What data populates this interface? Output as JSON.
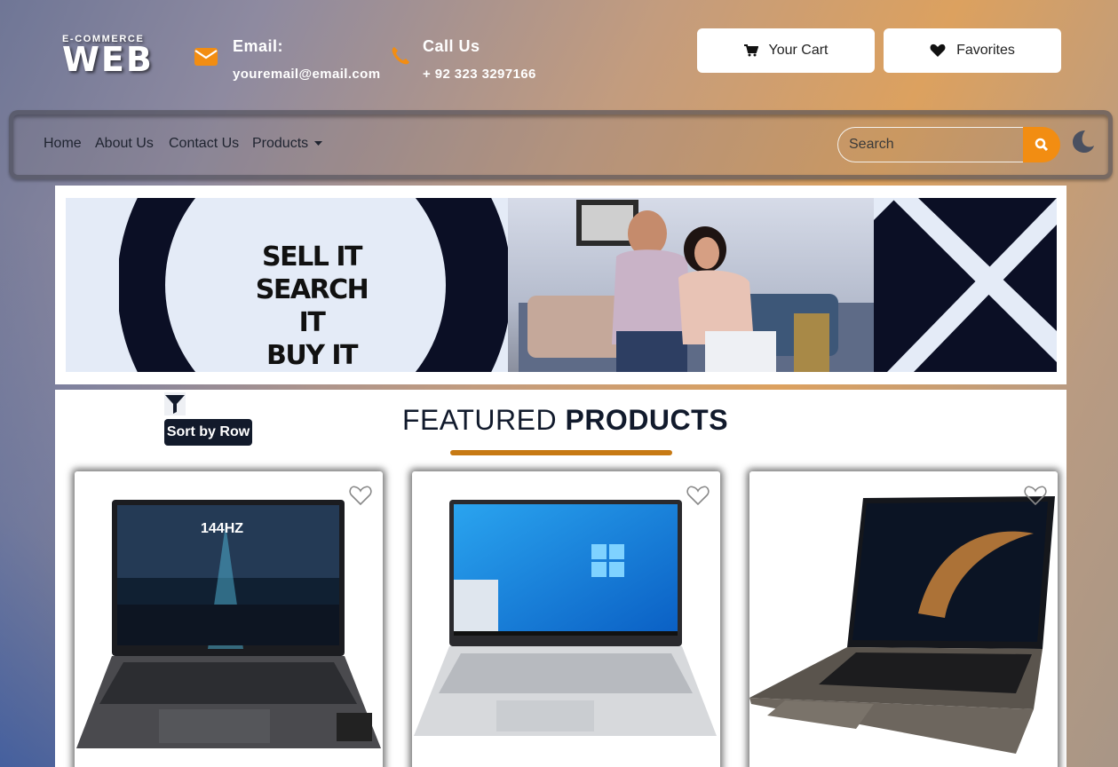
{
  "logo": {
    "small": "E-COMMERCE",
    "big": "WEB"
  },
  "contact": {
    "email_title": "Email:",
    "email_value": "youremail@email.com",
    "call_title": "Call Us",
    "call_value": "+ 92 323 3297166"
  },
  "header_buttons": {
    "cart": "Your Cart",
    "favorites": "Favorites"
  },
  "nav": {
    "items": [
      "Home",
      "About Us",
      "Contact Us",
      "Products"
    ],
    "search_placeholder": "Search"
  },
  "banner": {
    "lines": [
      "SELL IT",
      "SEARCH IT",
      "BUY IT"
    ]
  },
  "main": {
    "sort_label": "Sort by Row",
    "heading_light": "FEATURED ",
    "heading_bold": "PRODUCTS"
  },
  "products": [
    {
      "screen_text": "144HZ"
    },
    {
      "screen_text": ""
    },
    {
      "screen_text": ""
    }
  ],
  "colors": {
    "accent": "#f28d12",
    "underline": "#c77a14",
    "dark": "#121a2b"
  }
}
